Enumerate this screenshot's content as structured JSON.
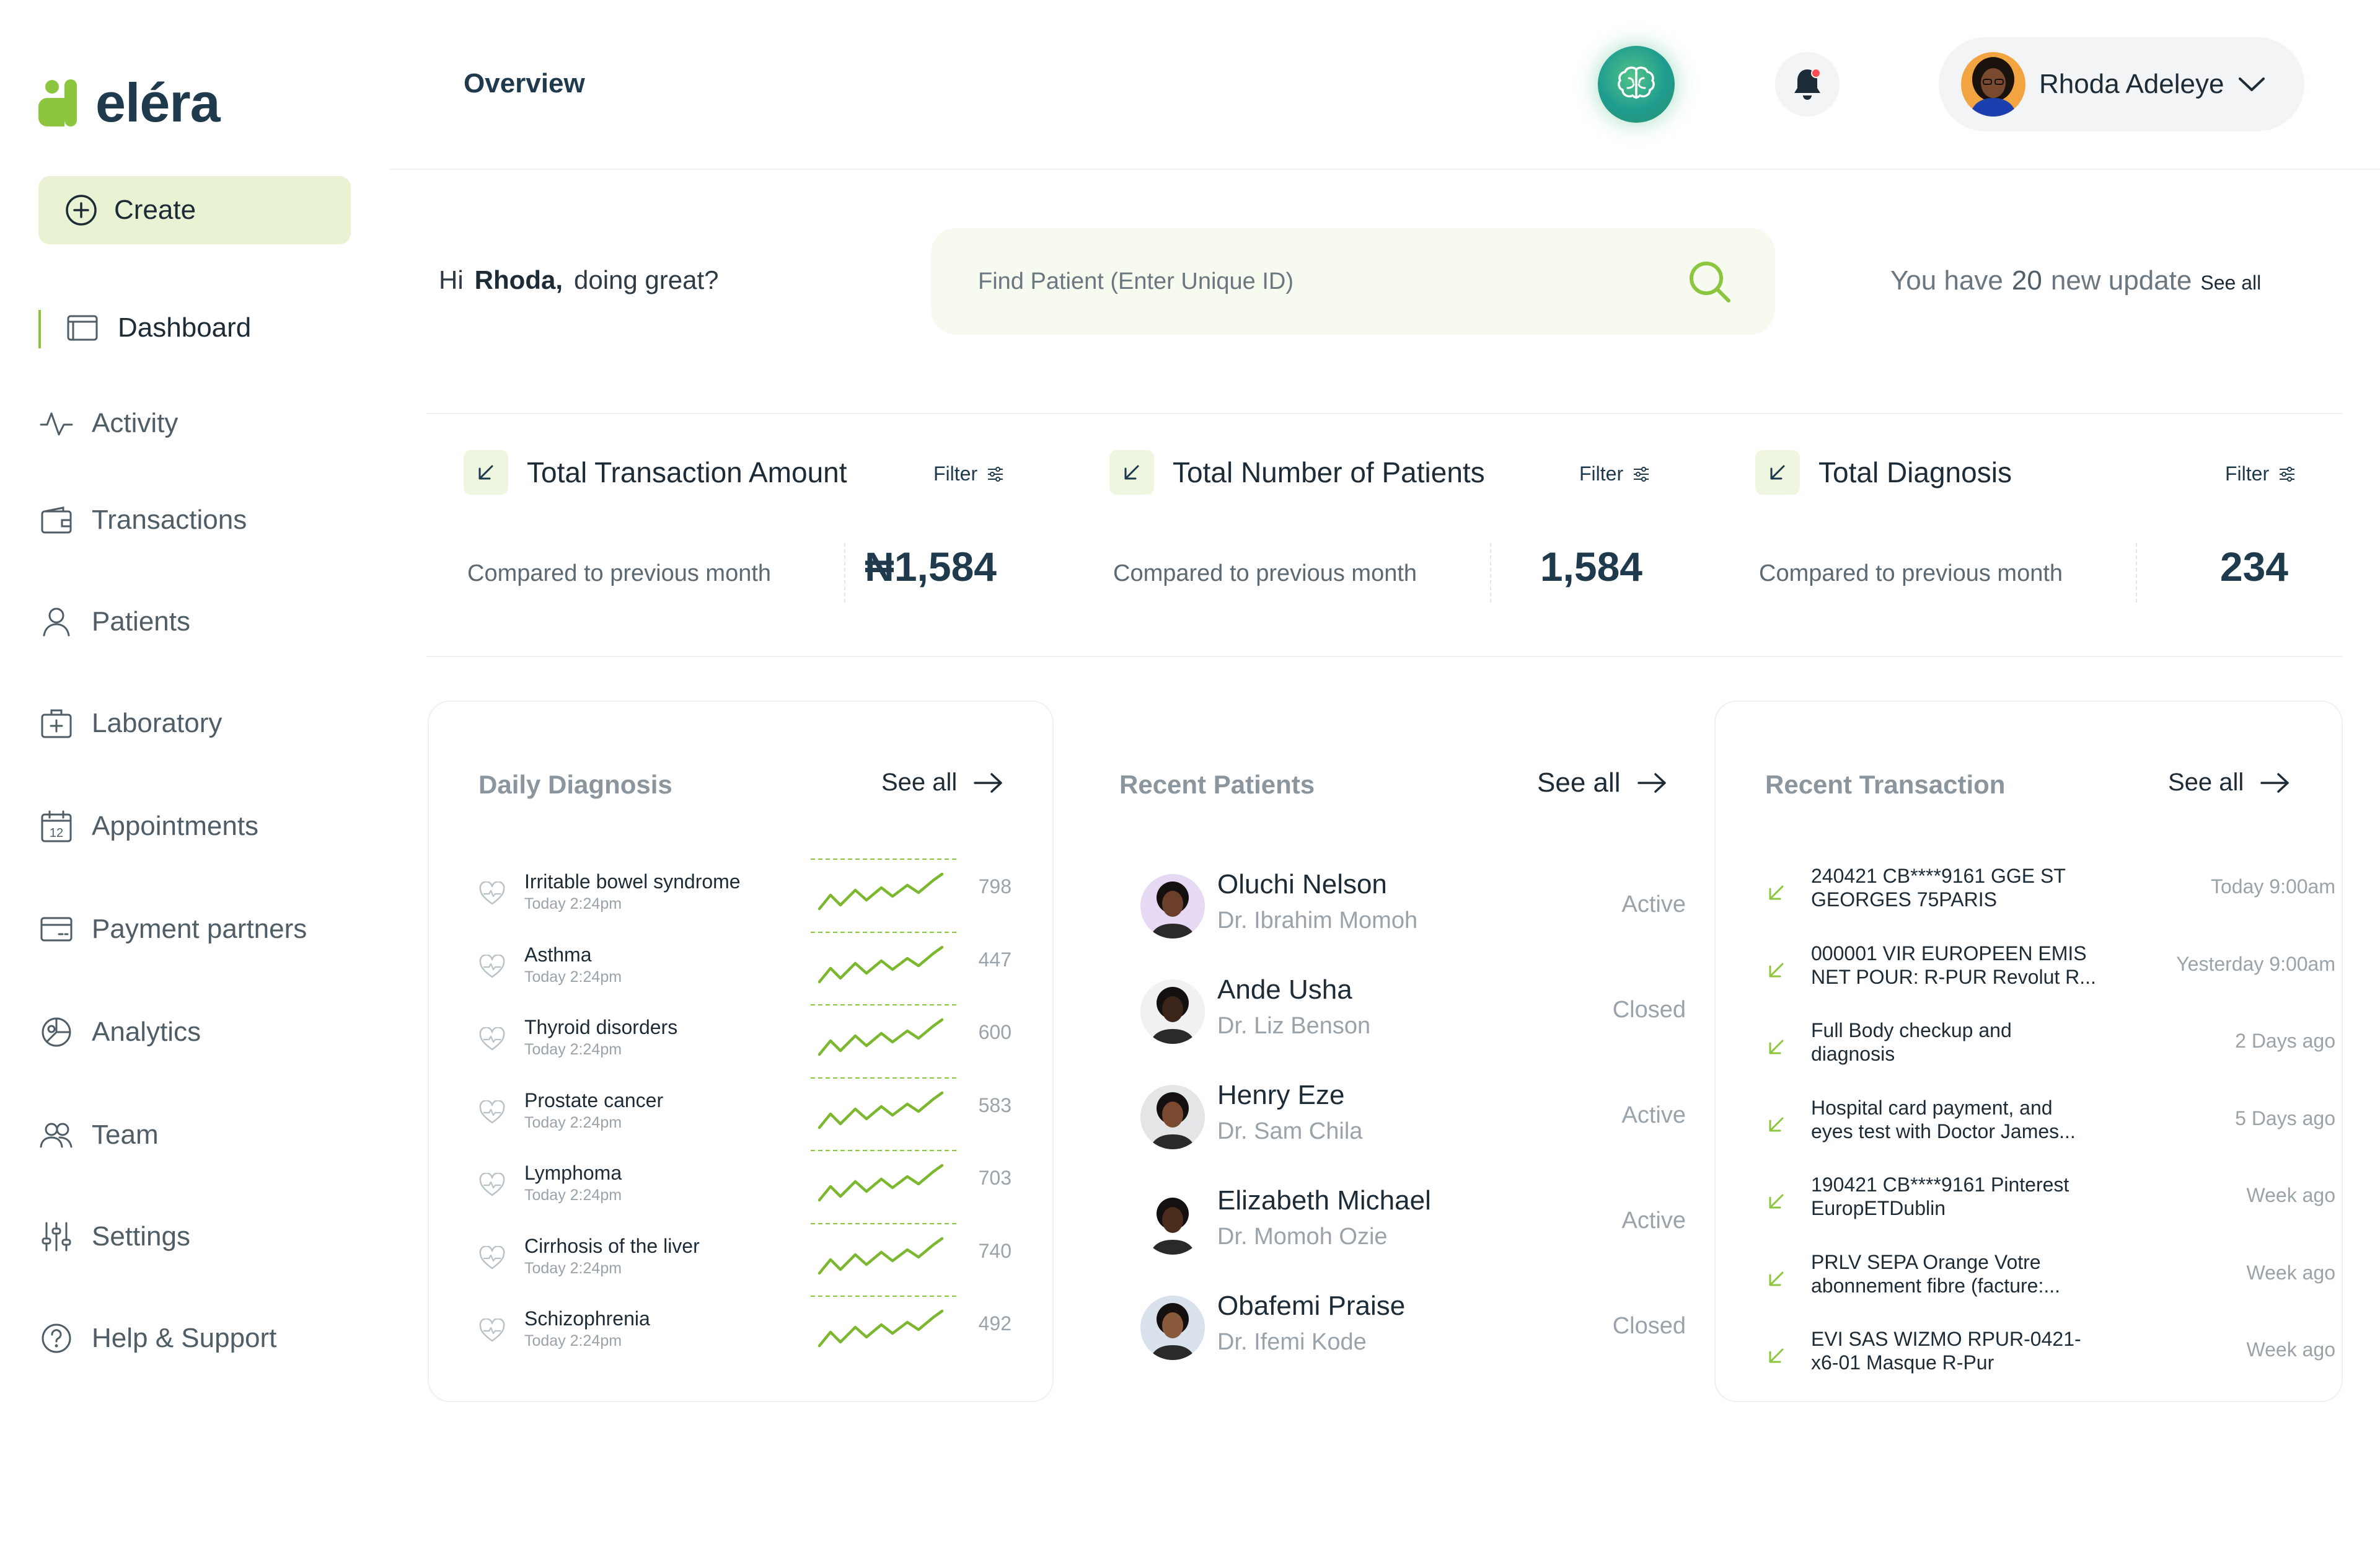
{
  "brand": {
    "name": "eléra",
    "accent": "#8cc63f",
    "dark": "#1e3a4c"
  },
  "sidebar": {
    "create_label": "Create",
    "items": [
      {
        "label": "Dashboard",
        "icon": "dashboard-icon",
        "active": true
      },
      {
        "label": "Activity",
        "icon": "activity-icon"
      },
      {
        "label": "Transactions",
        "icon": "wallet-icon"
      },
      {
        "label": "Patients",
        "icon": "user-icon"
      },
      {
        "label": "Laboratory",
        "icon": "medkit-icon"
      },
      {
        "label": "Appointments",
        "icon": "calendar-icon"
      },
      {
        "label": "Payment partners",
        "icon": "card-icon"
      },
      {
        "label": "Analytics",
        "icon": "analytics-icon"
      },
      {
        "label": "Team",
        "icon": "team-icon"
      },
      {
        "label": "Settings",
        "icon": "sliders-icon"
      },
      {
        "label": "Help & Support",
        "icon": "help-icon"
      }
    ],
    "calendar_day": "12"
  },
  "header": {
    "title": "Overview",
    "user_name": "Rhoda Adeleye"
  },
  "greeting": {
    "hi": "Hi",
    "name": "Rhoda,",
    "rest": "doing great?"
  },
  "search": {
    "placeholder": "Find Patient (Enter Unique ID)",
    "value": ""
  },
  "updates": {
    "prefix": "You have",
    "count": "20",
    "suffix": "new update",
    "see_all": "See all"
  },
  "stats": [
    {
      "title": "Total Transaction Amount",
      "filter": "Filter",
      "sub": "Compared to previous month",
      "value": "₦1,584"
    },
    {
      "title": "Total Number of Patients",
      "filter": "Filter",
      "sub": "Compared to previous month",
      "value": "1,584"
    },
    {
      "title": "Total Diagnosis",
      "filter": "Filter",
      "sub": "Compared to previous month",
      "value": "234"
    }
  ],
  "daily_diagnosis": {
    "title": "Daily Diagnosis",
    "see_all": "See all",
    "rows": [
      {
        "name": "Irritable bowel syndrome",
        "time": "Today 2:24pm",
        "value": "798"
      },
      {
        "name": "Asthma",
        "time": "Today 2:24pm",
        "value": "447"
      },
      {
        "name": "Thyroid disorders",
        "time": "Today 2:24pm",
        "value": "600"
      },
      {
        "name": "Prostate cancer",
        "time": "Today 2:24pm",
        "value": "583"
      },
      {
        "name": "Lymphoma",
        "time": "Today 2:24pm",
        "value": "703"
      },
      {
        "name": "Cirrhosis of the liver",
        "time": "Today 2:24pm",
        "value": "740"
      },
      {
        "name": "Schizophrenia",
        "time": "Today 2:24pm",
        "value": "492"
      }
    ]
  },
  "recent_patients": {
    "title": "Recent Patients",
    "see_all": "See all",
    "rows": [
      {
        "name": "Oluchi Nelson",
        "doctor": "Dr. Ibrahim Momoh",
        "status": "Active",
        "avatar_bg": "#e6d9f3",
        "skin": "#6b3f2a"
      },
      {
        "name": "Ande Usha",
        "doctor": "Dr. Liz Benson",
        "status": "Closed",
        "avatar_bg": "#f1f1f1",
        "skin": "#3b2418"
      },
      {
        "name": "Henry Eze",
        "doctor": "Dr. Sam Chila",
        "status": "Active",
        "avatar_bg": "#e3e5e7",
        "skin": "#7a4a30"
      },
      {
        "name": "Elizabeth Michael",
        "doctor": "Dr. Momoh Ozie",
        "status": "Active",
        "avatar_bg": "#ffffff",
        "skin": "#4a2c1d"
      },
      {
        "name": "Obafemi Praise",
        "doctor": "Dr. Ifemi Kode",
        "status": "Closed",
        "avatar_bg": "#d9e2ec",
        "skin": "#8a5a3c"
      }
    ]
  },
  "recent_transaction": {
    "title": "Recent Transaction",
    "see_all": "See all",
    "rows": [
      {
        "line1": "240421 CB****9161 GGE ST",
        "line2": "GEORGES 75PARIS",
        "time": "Today 9:00am"
      },
      {
        "line1": "000001 VIR EUROPEEN EMIS",
        "line2": "NET POUR: R-PUR Revolut R...",
        "time": "Yesterday 9:00am"
      },
      {
        "line1": "Full Body checkup and",
        "line2": "diagnosis",
        "time": "2 Days ago"
      },
      {
        "line1": "Hospital card payment, and",
        "line2": "eyes test with Doctor James...",
        "time": "5 Days ago"
      },
      {
        "line1": "190421 CB****9161 Pinterest",
        "line2": "EuropETDublin",
        "time": "Week ago"
      },
      {
        "line1": "PRLV SEPA Orange Votre",
        "line2": "abonnement fibre (facture:...",
        "time": "Week ago"
      },
      {
        "line1": "EVI SAS WIZMO RPUR-0421-",
        "line2": "x6-01 Masque R-Pur",
        "time": "Week ago"
      }
    ]
  }
}
